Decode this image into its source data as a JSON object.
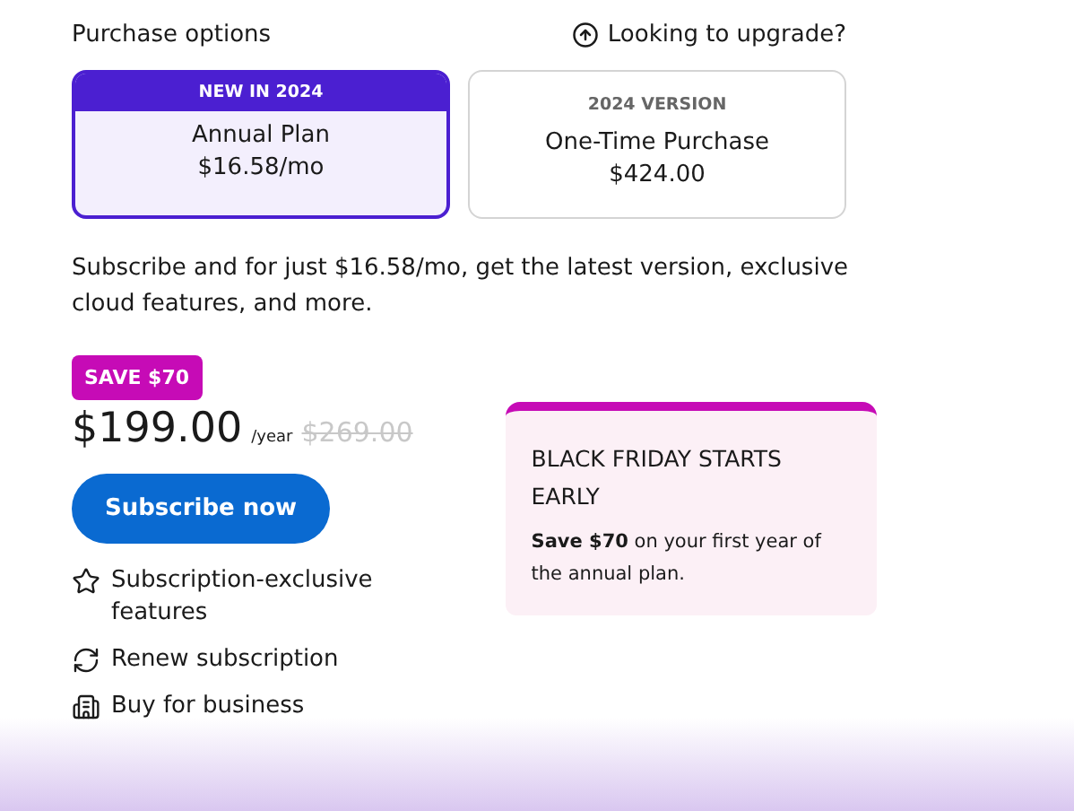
{
  "header": {
    "title": "Purchase options",
    "upgrade_link": "Looking to upgrade?"
  },
  "plans": [
    {
      "badge": "NEW IN 2024",
      "name": "Annual Plan",
      "price": "$16.58/mo",
      "selected": true
    },
    {
      "badge": "2024 VERSION",
      "name": "One-Time Purchase",
      "price": "$424.00",
      "selected": false
    }
  ],
  "description": "Subscribe and for just $16.58/mo, get the latest version, exclusive cloud features, and more.",
  "offer": {
    "save_badge": "SAVE $70",
    "price": "$199.00",
    "period": "/year",
    "old_price": "$269.00",
    "button": "Subscribe now"
  },
  "features": [
    {
      "kind": "star",
      "label": "Subscription-exclusive features"
    },
    {
      "kind": "renew",
      "label": "Renew subscription"
    },
    {
      "kind": "building",
      "label": "Buy for business"
    }
  ],
  "promo": {
    "title": "BLACK FRIDAY STARTS EARLY",
    "text": "**Save $70** on your first year of the annual plan."
  }
}
